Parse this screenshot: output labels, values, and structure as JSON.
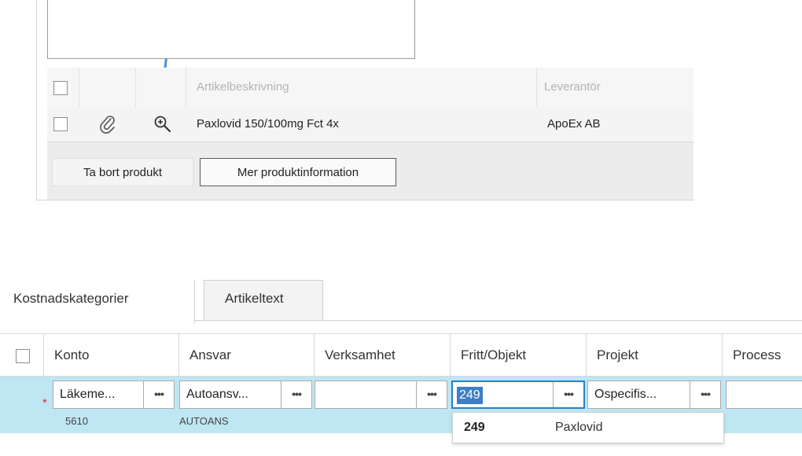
{
  "product_grid": {
    "header": {
      "description": "Artikelbeskrivning",
      "supplier": "Leverantör"
    },
    "row": {
      "description": "Paxlovid 150/100mg Fct 4x",
      "supplier": "ApoEx AB"
    },
    "buttons": {
      "remove": "Ta bort produkt",
      "more_info": "Mer produktinformation"
    },
    "icons": [
      "paperclip-icon",
      "zoom-in-icon"
    ]
  },
  "tabs": [
    {
      "label": "Kostnadskategorier",
      "active": true
    },
    {
      "label": "Artikeltext",
      "active": false
    }
  ],
  "cost_grid": {
    "columns": [
      "Konto",
      "Ansvar",
      "Verksamhet",
      "Fritt/Objekt",
      "Projekt",
      "Process"
    ],
    "required_marker": "*",
    "fields": {
      "konto": {
        "value": "Läkeme...",
        "sub": "5610"
      },
      "ansvar": {
        "value": "Autoansv...",
        "sub": "AUTOANS"
      },
      "verksamhet": {
        "value": ""
      },
      "fritt": {
        "value": "249"
      },
      "projekt": {
        "value": "Ospecifis..."
      },
      "process": {
        "value": ""
      }
    },
    "lookup_button": "•••",
    "suggestion": {
      "code": "249",
      "name": "Paxlovid"
    }
  },
  "colors": {
    "row_highlight": "#bfe6f3",
    "focus_border": "#2a7fc8",
    "selection": "#3d7fc4",
    "arrow": "#4a8fd0",
    "required": "#d43030"
  }
}
